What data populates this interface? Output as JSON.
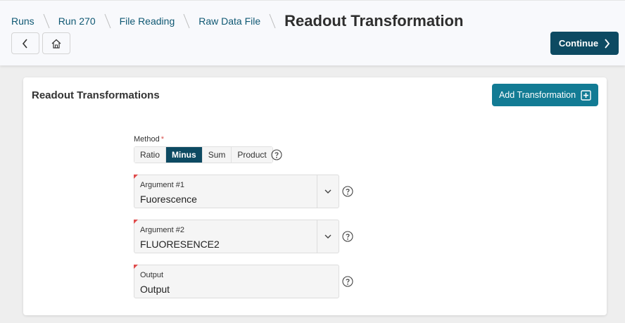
{
  "breadcrumbs": [
    "Runs",
    "Run 270",
    "File Reading",
    "Raw Data File"
  ],
  "page_title": "Readout Transformation",
  "continue_label": "Continue",
  "card": {
    "title": "Readout Transformations",
    "add_label": "Add Transformation"
  },
  "method": {
    "label": "Method",
    "required_mark": "*",
    "options": [
      "Ratio",
      "Minus",
      "Sum",
      "Product"
    ],
    "selected": "Minus"
  },
  "fields": [
    {
      "label": "Argument #1",
      "value": "Fuorescence",
      "type": "select"
    },
    {
      "label": "Argument #2",
      "value": "FLUORESENCE2",
      "type": "select"
    },
    {
      "label": "Output",
      "value": "Output",
      "type": "text"
    }
  ],
  "icons": {
    "back": "chevron-left-icon",
    "home": "home-icon",
    "continue": "chevron-right-icon",
    "add": "plus-square-icon",
    "help": "question-circle-icon",
    "dropdown": "chevron-down-icon"
  },
  "colors": {
    "link": "#0f5873",
    "primary_dark": "#0d4a62",
    "primary": "#127b94",
    "required": "#e04b4b"
  }
}
